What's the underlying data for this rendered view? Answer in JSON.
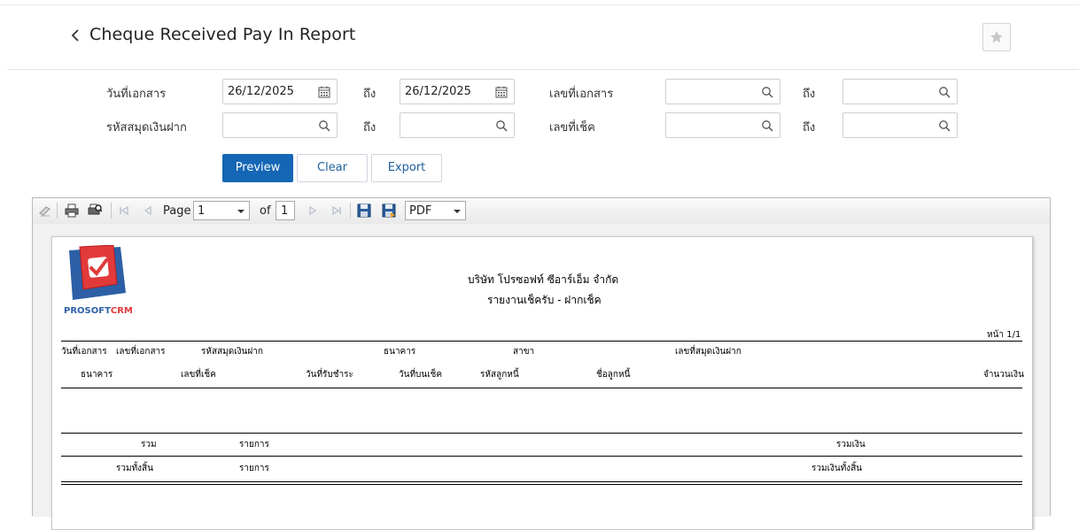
{
  "header": {
    "title": "Cheque Received Pay In Report"
  },
  "filters": {
    "doc_date_label": "วันที่เอกสาร",
    "doc_date_from": "26/12/2025",
    "to_label": "ถึง",
    "doc_date_to": "26/12/2025",
    "doc_no_label": "เลขที่เอกสาร",
    "deposit_book_label": "รหัสสมุดเงินฝาก",
    "cheque_no_label": "เลขที่เช็ค"
  },
  "buttons": {
    "preview": "Preview",
    "clear": "Clear",
    "export": "Export"
  },
  "toolbar": {
    "page_label": "Page",
    "page_value": "1",
    "of_label": "of",
    "total_pages": "1",
    "format": "PDF"
  },
  "report": {
    "logo_text_a": "PROSOFT",
    "logo_text_b": "CRM",
    "company": "บริษัท โปรซอฟท์ ซีอาร์เอ็ม จำกัด",
    "title": "รายงานเช็ครับ - ฝากเช็ค",
    "page_info": "หน้า 1/1",
    "header_row1": [
      "วันที่เอกสาร",
      "เลขที่เอกสาร",
      "รหัสสมุดเงินฝาก",
      "ธนาคาร",
      "สาขา",
      "เลขที่สมุดเงินฝาก"
    ],
    "header_row2": [
      "ธนาคาร",
      "เลขที่เช็ค",
      "วันที่รับชำระ",
      "วันที่บนเช็ค",
      "รหัสลูกหนี้",
      "ชื่อลูกหนี้",
      "จำนวนเงิน"
    ],
    "sum_label": "รวม",
    "items_label": "รายการ",
    "sum_amount_label": "รวมเงิน",
    "grand_total_label": "รวมทั้งสิ้น",
    "grand_items_label": "รายการ",
    "grand_amount_label": "รวมเงินทั้งสิ้น"
  }
}
